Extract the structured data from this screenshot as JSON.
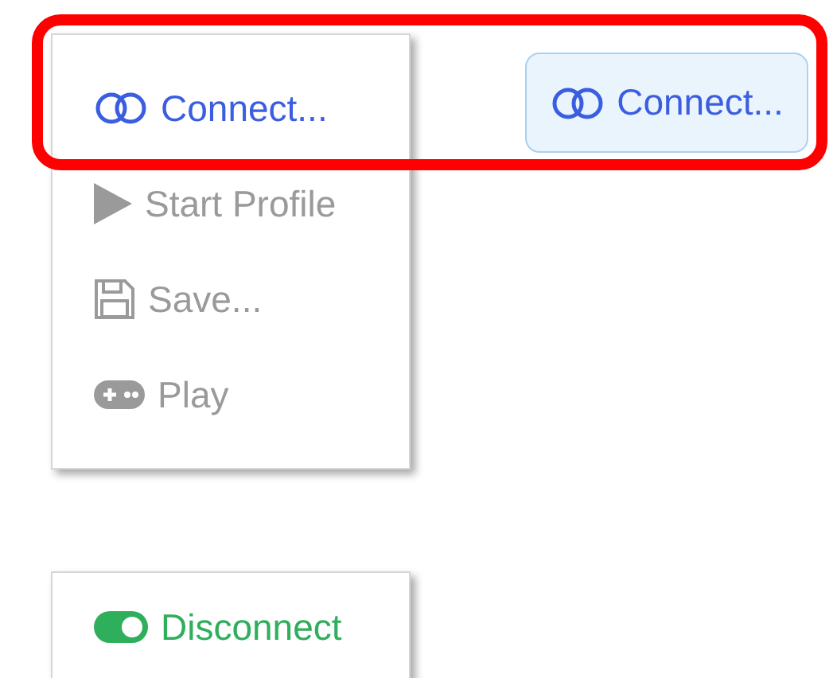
{
  "menu": {
    "items": [
      {
        "label": "Connect...",
        "kind": "connect",
        "disabled": false
      },
      {
        "label": "Start Profile",
        "kind": "start",
        "disabled": true
      },
      {
        "label": "Save...",
        "kind": "save",
        "disabled": true
      },
      {
        "label": "Play",
        "kind": "play",
        "disabled": true
      }
    ]
  },
  "connect_button": {
    "label": "Connect...",
    "kind": "connect"
  },
  "connected_menu": {
    "items": [
      {
        "label": "Disconnect",
        "kind": "disconnect",
        "disabled": false
      }
    ]
  }
}
